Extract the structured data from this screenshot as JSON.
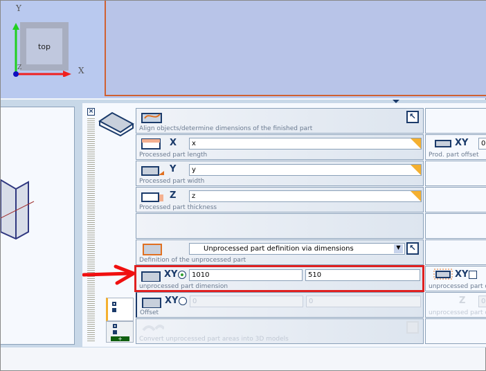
{
  "viewport": {
    "cube_label": "top",
    "axis_x": "X",
    "axis_y": "Y",
    "axis_z": "Z"
  },
  "rows": [
    {
      "label": "Align objects/determine dimensions of the finished part",
      "icon": "finished-part-align-icon"
    },
    {
      "label": "Processed part length",
      "axis": "X",
      "value": "x",
      "icon": "length-icon"
    },
    {
      "label": "Processed part width",
      "axis": "Y",
      "value": "y",
      "icon": "width-icon"
    },
    {
      "label": "Processed part thickness",
      "axis": "Z",
      "value": "z",
      "icon": "thickness-icon"
    },
    {
      "label": "Definition of the unprocessed part",
      "dropdown": "Unprocessed part definition via dimensions"
    },
    {
      "label": "unprocessed part dimension",
      "axis": "XY",
      "value1": "1010",
      "value2": "510",
      "selected": true
    },
    {
      "label": "Offset",
      "axis": "XY",
      "value1": "0",
      "value2": "0",
      "selected": false
    },
    {
      "label": "Convert unprocessed part areas into 3D models"
    }
  ],
  "right": {
    "prod_offset": {
      "label": "Prod. part offset",
      "axis": "XY",
      "value": "0"
    },
    "unproc_offset": {
      "label": "unprocessed part o",
      "axis": "XY"
    },
    "unproc_z": {
      "label": "unprocessed part o",
      "axis": "Z",
      "value": "0"
    }
  },
  "colors": {
    "highlight": "#e02020",
    "accent": "#f4b030",
    "dark": "#1a3a6a"
  }
}
